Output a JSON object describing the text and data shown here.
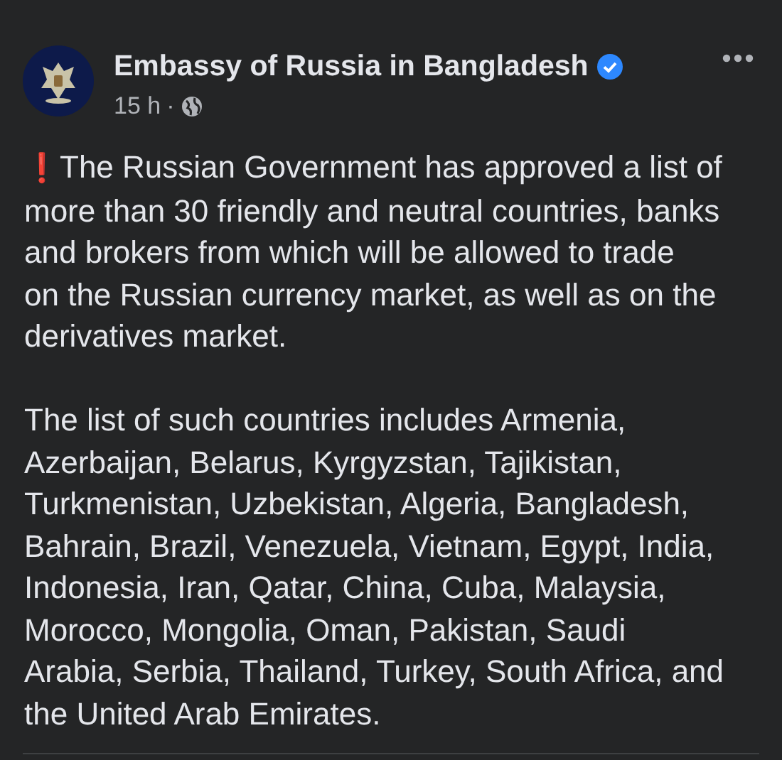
{
  "post": {
    "author": "Embassy of Russia in Bangladesh",
    "verified": true,
    "time": "15 h",
    "separator": "·",
    "paragraphs": [
      {
        "emoji": "❗",
        "lines": [
          "The Russian Government has approved a list of",
          "more than 30 friendly and neutral countries, banks",
          "and brokers from which will be allowed to trade",
          "on the Russian currency market, as well as on the",
          "derivatives market."
        ]
      },
      {
        "lines": [
          "The list of such countries includes Armenia,",
          "Azerbaijan, Belarus, Kyrgyzstan, Tajikistan,",
          "Turkmenistan, Uzbekistan, Algeria, Bangladesh,",
          "Bahrain, Brazil, Venezuela, Vietnam, Egypt, India,",
          "Indonesia, Iran, Qatar, China, Cuba, Malaysia,",
          "Morocco, Mongolia, Oman, Pakistan, Saudi",
          "Arabia, Serbia, Thailand, Turkey, South Africa, and",
          "the United Arab Emirates."
        ]
      }
    ]
  }
}
